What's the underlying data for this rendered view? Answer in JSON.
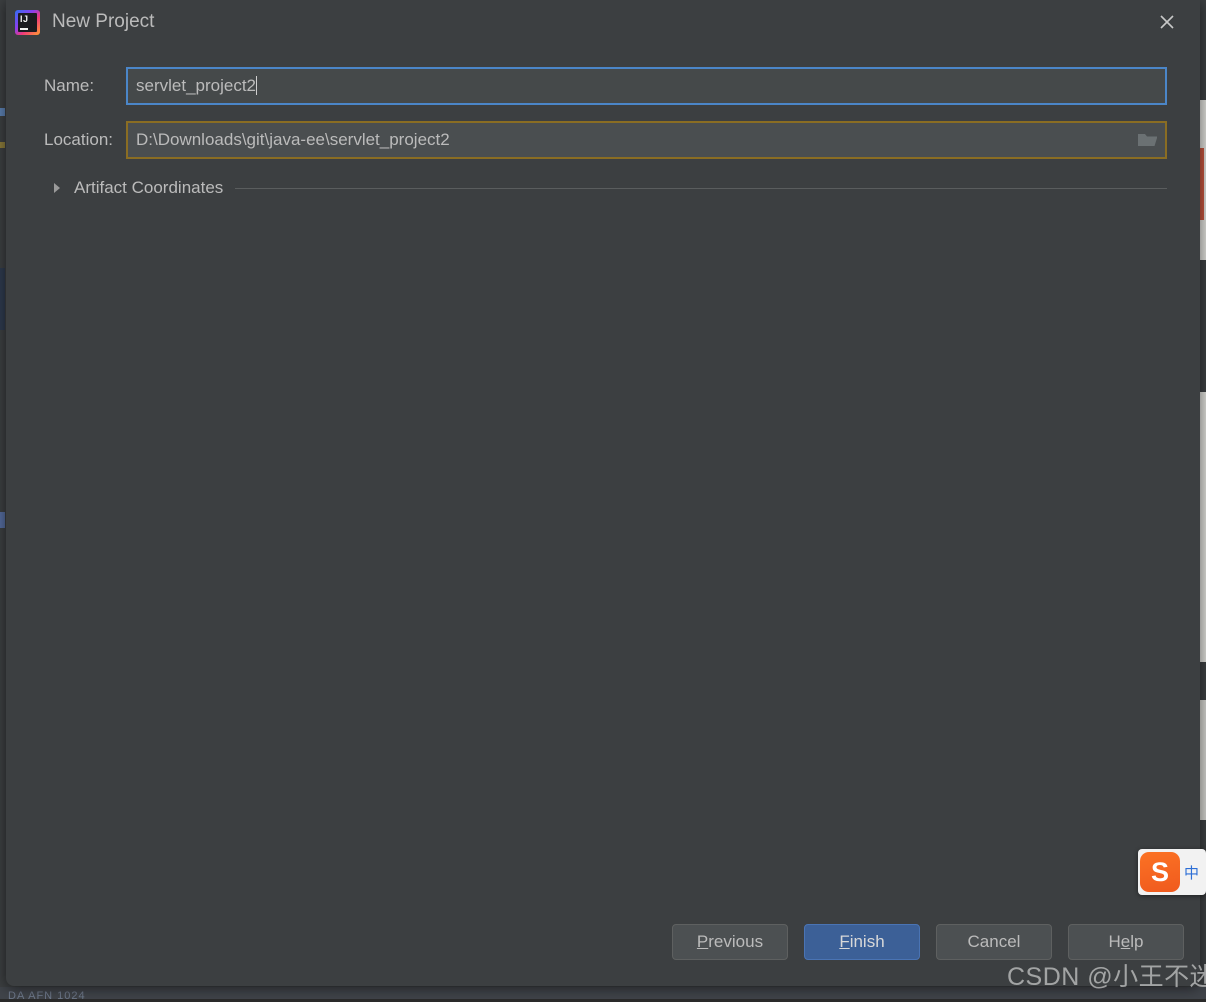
{
  "window": {
    "title": "New Project",
    "app_icon": "intellij-idea-icon",
    "close_icon": "close-icon"
  },
  "form": {
    "name_field": {
      "label": "Name:",
      "value": "servlet_project2",
      "focused": true
    },
    "location_field": {
      "label": "Location:",
      "value": "D:\\Downloads\\git\\java-ee\\servlet_project2",
      "browse_icon": "folder-icon",
      "state": "warning"
    },
    "artifact_section": {
      "label": "Artifact Coordinates",
      "expanded": false,
      "arrow_icon": "triangle-right-icon"
    }
  },
  "buttons": {
    "previous": {
      "label": "Previous",
      "mnemonic": "P"
    },
    "finish": {
      "label": "Finish",
      "mnemonic": "F",
      "primary": true
    },
    "cancel": {
      "label": "Cancel",
      "mnemonic": ""
    },
    "help": {
      "label": "Help",
      "mnemonic": "e"
    }
  },
  "overlays": {
    "ime_widget": {
      "logo_letter": "S",
      "label": "中"
    },
    "watermark": "CSDN @小王不迷糊",
    "background_text": "DA AFN 1024"
  },
  "colors": {
    "dialog_bg": "#3c3f41",
    "text": "#bbbbbb",
    "field_bg": "#45494a",
    "focus_border": "#4b86c8",
    "warn_border": "#8a6d23",
    "primary_button": "#3c6097",
    "button_bg": "#4c5052"
  }
}
